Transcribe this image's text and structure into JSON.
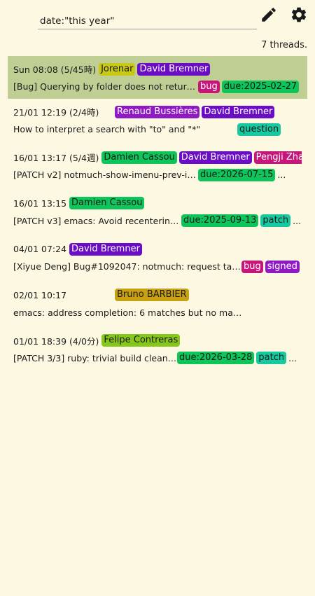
{
  "search": {
    "value": "date:\"this year\""
  },
  "toolbar": {
    "edit_icon": "pencil-icon",
    "settings_icon": "gear-icon"
  },
  "thread_count": "7 threads.",
  "colors": {
    "background": "#fdf8e1",
    "selected": "#bfcf94",
    "purple": "#6a0dc4",
    "magenta": "#c8157a",
    "green": "#0ec55a",
    "teal": "#16c9a0",
    "olive": "#c9c815",
    "gold": "#c9a012",
    "lime": "#86c81a"
  },
  "threads": [
    {
      "date": "Sun 08:08 (5/45時)",
      "authors": [
        {
          "name": "Jorenar",
          "bg": "#c9c815",
          "fg": "#1a1a1a"
        },
        {
          "name": "David Bremner",
          "bg": "#6a0dc4",
          "fg": "#ffffff"
        }
      ],
      "subject": "[Bug] Querying by folder does not return...",
      "tags": [
        {
          "name": "bug",
          "bg": "#c8157a",
          "fg": "#ffffff"
        },
        {
          "name": "due:2025-02-27",
          "bg": "#0ec55a",
          "fg": "#1a1a1a"
        }
      ],
      "more": "...",
      "selected": true
    },
    {
      "date": "21/01 12:19 (2/4時)",
      "authors": [
        {
          "name": "Renaud Bussières",
          "bg": "#8f1ac4",
          "fg": "#ffffff"
        },
        {
          "name": "David Bremner",
          "bg": "#6a0dc4",
          "fg": "#ffffff"
        }
      ],
      "subject": "How to interpret a search with \"to\" and \"*\"",
      "tags": [
        {
          "name": "question",
          "bg": "#16c9a0",
          "fg": "#1a1a1a"
        }
      ],
      "more": ""
    },
    {
      "date": "16/01 13:17 (5/4週)",
      "authors": [
        {
          "name": "Damien Cassou",
          "bg": "#0ec55a",
          "fg": "#1a1a1a"
        },
        {
          "name": "David Bremner",
          "bg": "#6a0dc4",
          "fg": "#ffffff"
        },
        {
          "name": "Pengji Zhang",
          "bg": "#c8157a",
          "fg": "#ffffff"
        }
      ],
      "subject": "[PATCH v2] notmuch-show-imenu-prev-in...",
      "tags": [
        {
          "name": "due:2026-07-15",
          "bg": "#0ec55a",
          "fg": "#1a1a1a"
        }
      ],
      "more": "..."
    },
    {
      "date": "16/01 13:15",
      "authors": [
        {
          "name": "Damien Cassou",
          "bg": "#0ec55a",
          "fg": "#1a1a1a"
        }
      ],
      "subject": "[PATCH v3] emacs: Avoid recentering ...",
      "tags": [
        {
          "name": "due:2025-09-13",
          "bg": "#0ec55a",
          "fg": "#1a1a1a"
        },
        {
          "name": "patch",
          "bg": "#16c9a0",
          "fg": "#1a1a1a"
        }
      ],
      "more": "..."
    },
    {
      "date": "04/01 07:24",
      "authors": [
        {
          "name": "David Bremner",
          "bg": "#6a0dc4",
          "fg": "#ffffff"
        }
      ],
      "subject": "[Xiyue Deng] Bug#1092047: notmuch: request taggin...",
      "tags": [
        {
          "name": "bug",
          "bg": "#c8157a",
          "fg": "#ffffff"
        },
        {
          "name": "signed",
          "bg": "#8f1ac4",
          "fg": "#ffffff"
        }
      ],
      "more": ""
    },
    {
      "date": "02/01 10:17",
      "authors": [
        {
          "name": "Bruno BARBIER",
          "bg": "#c9a012",
          "fg": "#1a1a1a"
        }
      ],
      "subject": "emacs: address completion: 6 matches but no match",
      "tags": [],
      "more": ""
    },
    {
      "date": "01/01 18:39 (4/0分)",
      "authors": [
        {
          "name": "Felipe Contreras",
          "bg": "#86c81a",
          "fg": "#1a1a1a"
        }
      ],
      "subject": "[PATCH 3/3] ruby: trivial build cleanup",
      "tags": [
        {
          "name": "due:2026-03-28",
          "bg": "#0ec55a",
          "fg": "#1a1a1a"
        },
        {
          "name": "patch",
          "bg": "#16c9a0",
          "fg": "#1a1a1a"
        }
      ],
      "more": "..."
    }
  ]
}
